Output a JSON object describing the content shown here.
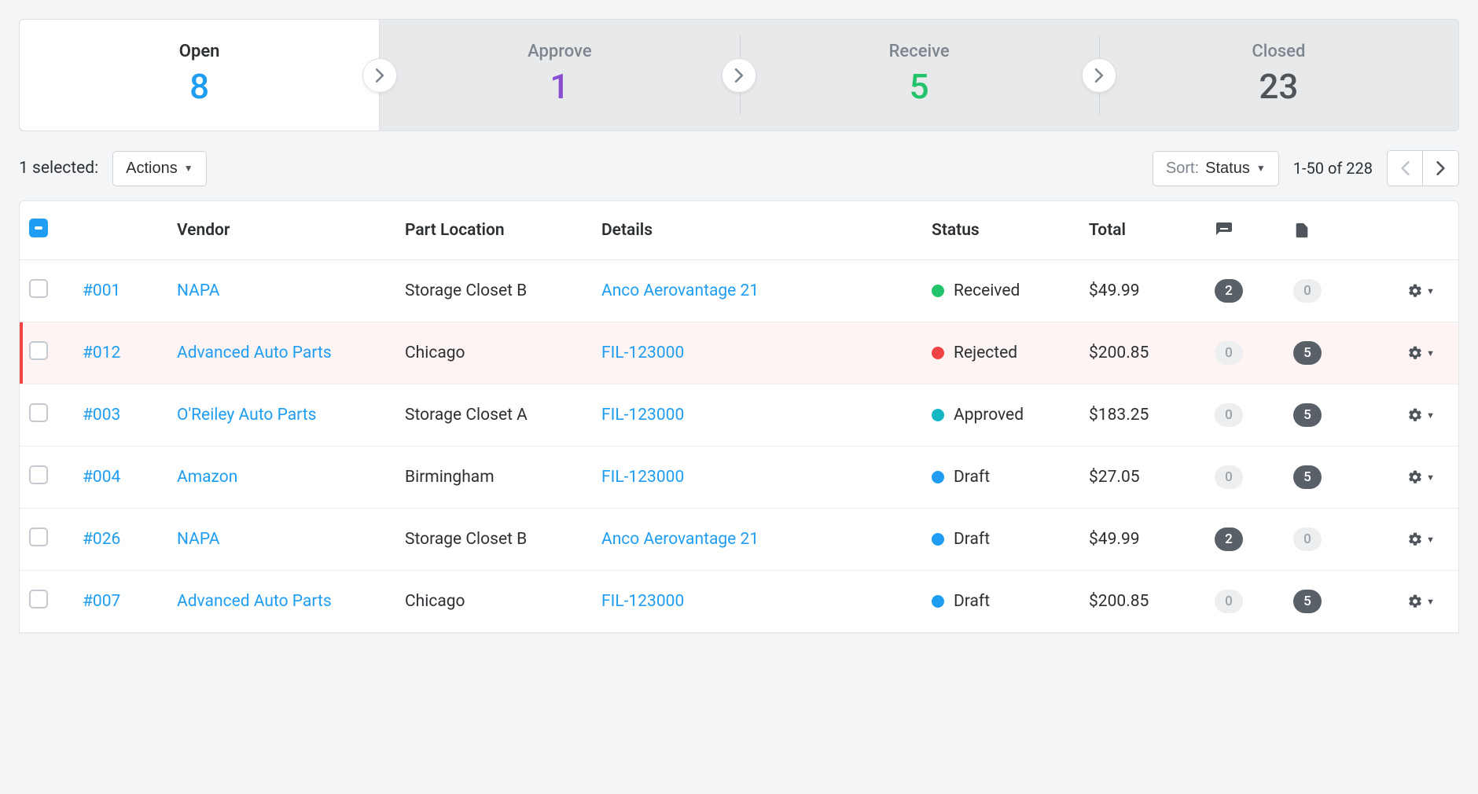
{
  "tabs": [
    {
      "key": "open",
      "label": "Open",
      "count": "8",
      "countClass": "cnt-open",
      "active": true
    },
    {
      "key": "approve",
      "label": "Approve",
      "count": "1",
      "countClass": "cnt-approve",
      "active": false
    },
    {
      "key": "receive",
      "label": "Receive",
      "count": "5",
      "countClass": "cnt-receive",
      "active": false
    },
    {
      "key": "closed",
      "label": "Closed",
      "count": "23",
      "countClass": "cnt-closed",
      "active": false
    }
  ],
  "toolbar": {
    "selected_text": "1 selected:",
    "actions_label": "Actions",
    "sort_prefix": "Sort:",
    "sort_value": "Status",
    "range_text": "1-50 of 228"
  },
  "columns": {
    "vendor": "Vendor",
    "part_location": "Part Location",
    "details": "Details",
    "status": "Status",
    "total": "Total"
  },
  "rows": [
    {
      "id": "#001",
      "vendor": "NAPA",
      "location": "Storage Closet B",
      "details": "Anco Aerovantage 21",
      "status": "Received",
      "statusClass": "received",
      "total": "$49.99",
      "comments": "2",
      "commentsDark": true,
      "docs": "0",
      "docsDark": false,
      "rowClass": ""
    },
    {
      "id": "#012",
      "vendor": "Advanced Auto Parts",
      "location": "Chicago",
      "details": "FIL-123000",
      "status": "Rejected",
      "statusClass": "rejected",
      "total": "$200.85",
      "comments": "0",
      "commentsDark": false,
      "docs": "5",
      "docsDark": true,
      "rowClass": "rejected"
    },
    {
      "id": "#003",
      "vendor": "O'Reiley Auto Parts",
      "location": "Storage Closet A",
      "details": "FIL-123000",
      "status": "Approved",
      "statusClass": "approved",
      "total": "$183.25",
      "comments": "0",
      "commentsDark": false,
      "docs": "5",
      "docsDark": true,
      "rowClass": ""
    },
    {
      "id": "#004",
      "vendor": "Amazon",
      "location": "Birmingham",
      "details": "FIL-123000",
      "status": "Draft",
      "statusClass": "draft",
      "total": "$27.05",
      "comments": "0",
      "commentsDark": false,
      "docs": "5",
      "docsDark": true,
      "rowClass": ""
    },
    {
      "id": "#026",
      "vendor": "NAPA",
      "location": "Storage Closet B",
      "details": "Anco Aerovantage 21",
      "status": "Draft",
      "statusClass": "draft",
      "total": "$49.99",
      "comments": "2",
      "commentsDark": true,
      "docs": "0",
      "docsDark": false,
      "rowClass": ""
    },
    {
      "id": "#007",
      "vendor": "Advanced Auto Parts",
      "location": "Chicago",
      "details": "FIL-123000",
      "status": "Draft",
      "statusClass": "draft",
      "total": "$200.85",
      "comments": "0",
      "commentsDark": false,
      "docs": "5",
      "docsDark": true,
      "rowClass": ""
    }
  ]
}
